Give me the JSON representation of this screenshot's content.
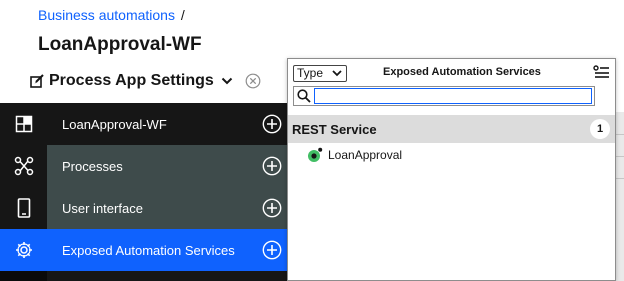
{
  "breadcrumb": {
    "link": "Business automations",
    "separator": "/"
  },
  "page_title": "LoanApproval-WF",
  "settings_menu": {
    "label": "Process App Settings"
  },
  "sidebar": {
    "items": [
      {
        "label": "LoanApproval-WF",
        "icon": "dashboard-icon"
      },
      {
        "label": "Processes",
        "icon": "flow-icon"
      },
      {
        "label": "User interface",
        "icon": "mobile-icon"
      },
      {
        "label": "Exposed Automation Services",
        "icon": "gear-network-icon",
        "active": true
      }
    ]
  },
  "popover": {
    "type_select": {
      "value": "Type"
    },
    "title": "Exposed Automation Services",
    "search": {
      "value": "",
      "placeholder": ""
    },
    "group": {
      "label": "REST Service",
      "count": "1"
    },
    "items": [
      {
        "label": "LoanApproval",
        "icon": "service-status-icon"
      }
    ]
  },
  "colors": {
    "accent": "#0f62fe",
    "sidebar_dark": "#161616",
    "sidebar_mid": "#3e4b4b",
    "status_green": "#42be65"
  }
}
